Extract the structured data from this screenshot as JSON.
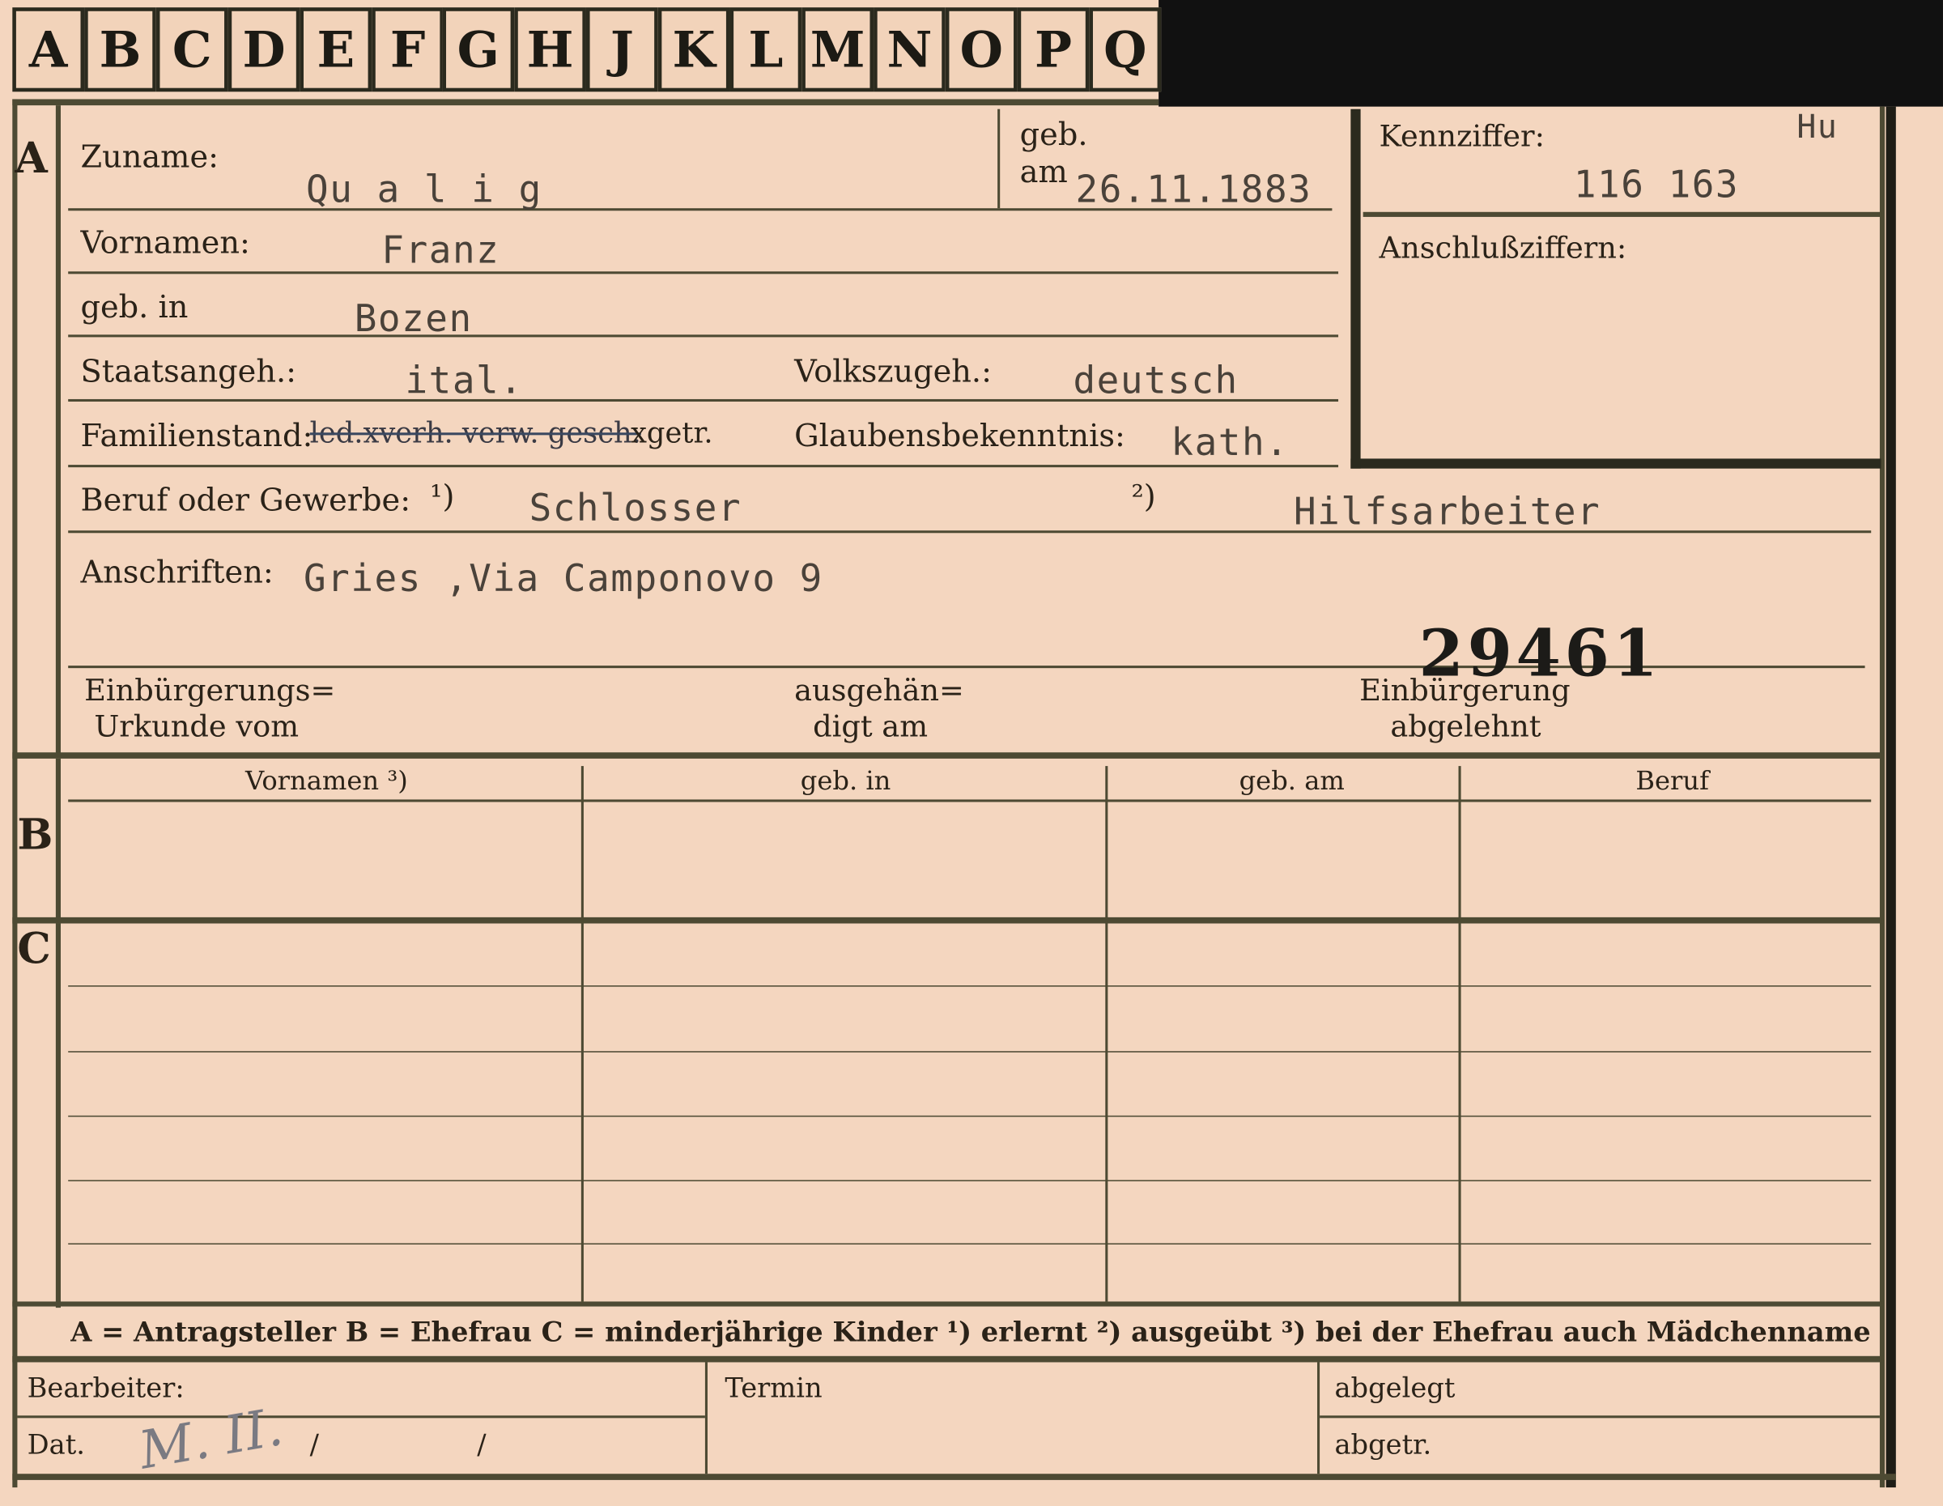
{
  "tabs": [
    "A",
    "B",
    "C",
    "D",
    "E",
    "F",
    "G",
    "H",
    "J",
    "K",
    "L",
    "M",
    "N",
    "O",
    "P",
    "Q"
  ],
  "section_letters": {
    "a": "A",
    "b": "B",
    "c": "C"
  },
  "labels": {
    "zuname": "Zuname:",
    "geb": "geb.",
    "am": "am",
    "kennziffer": "Kennziffer:",
    "anschlussziffern": "Anschlußziffern:",
    "vornamen": "Vornamen:",
    "geb_in": "geb. in",
    "staatsangeh": "Staatsangeh.:",
    "volkszugeh": "Volkszugeh.:",
    "familienstand": "Familienstand:",
    "glaubensbekenntnis": "Glaubensbekenntnis:",
    "beruf": "Beruf oder Gewerbe:",
    "beruf_note1": "¹)",
    "beruf_note2": "²)",
    "anschriften": "Anschriften:",
    "einbuergerungsurkunde_1": "Einbürgerungs=",
    "einbuergerungsurkunde_2": "Urkunde vom",
    "ausgehaendigt_1": "ausgehän=",
    "ausgehaendigt_2": "digt am",
    "einbuergerung_1": "Einbürgerung",
    "einbuergerung_2": "abgelehnt",
    "col_vornamen": "Vornamen ³)",
    "col_geb_in": "geb. in",
    "col_geb_am": "geb. am",
    "col_beruf": "Beruf",
    "legend": "A = Antragsteller   B = Ehefrau   C = minderjährige Kinder   ¹) erlernt   ²) ausgeübt   ³) bei der Ehefrau auch Mädchenname",
    "bearbeiter": "Bearbeiter:",
    "termin": "Termin",
    "abgelegt": "abgelegt",
    "dat": "Dat.",
    "abgetr": "abgetr.",
    "dat_slash1": "/",
    "dat_slash2": "/"
  },
  "values": {
    "zuname": "Qu a l i g",
    "geb_am": "26.11.1883",
    "kennziffer_code": "Hu",
    "kennziffer": "116 163",
    "vornamen": "Franz",
    "geb_in": "Bozen",
    "staatsangeh": "ital.",
    "volkszugeh": "deutsch",
    "familienstand_struck": "led.xverh. verw. gesch.",
    "familienstand_rest": "xgetr.",
    "glaubensbekenntnis": "kath.",
    "beruf_erlernt": "Schlosser",
    "beruf_ausgeuebt": "Hilfsarbeiter",
    "anschrift": "Gries ,Via Camponovo 9",
    "stamp_number": "29461",
    "dat_handwritten": "M. II."
  },
  "colors": {
    "card": "#f4d6bf",
    "ink": "#2a2218",
    "line": "#4d4a33",
    "typewriter": "#4a423a"
  }
}
